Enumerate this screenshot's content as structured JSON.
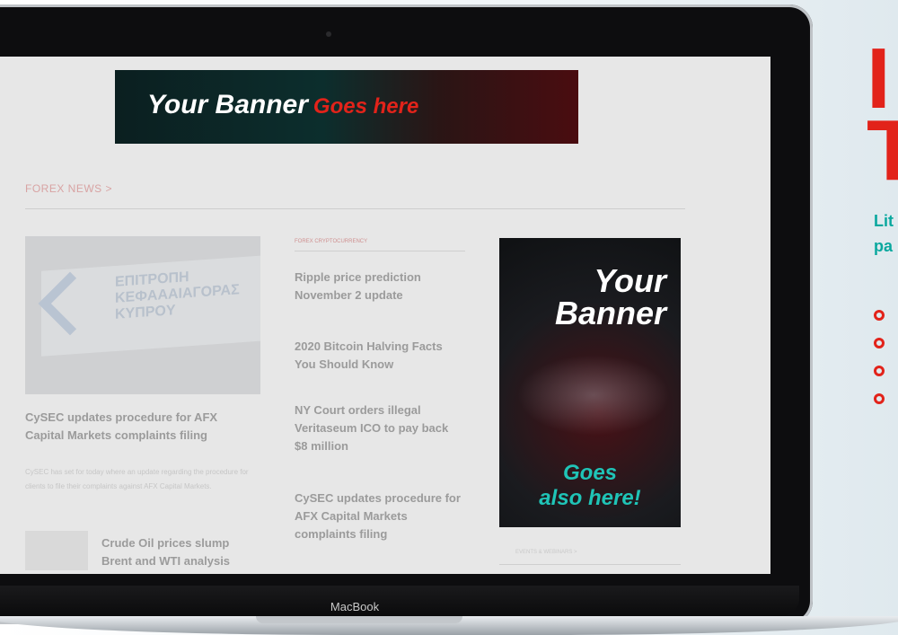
{
  "promo": {
    "headline_line1": "I",
    "headline_line2": "T",
    "lede_line1": "Lit",
    "lede_line2": "pa",
    "bullet_count": 4,
    "colors": {
      "headline": "#e2231a",
      "lede": "#0aa89e",
      "bullet": "#e2231a"
    }
  },
  "laptop": {
    "brand": "MacBook"
  },
  "site": {
    "top_banner": {
      "main": "Your Banner",
      "sub": "Goes here"
    },
    "section_title": "FOREX NEWS >",
    "featured_image_text": [
      "EПITPOПH",
      "KEФAAAIAГOPAΣ",
      "KYПPOY"
    ],
    "featured": {
      "headline_line1": "CySEC updates procedure for AFX",
      "headline_line2": "Capital Markets complaints filing",
      "excerpt": "CySEC has set for today where an update regarding the procedure for clients to file their complaints against AFX Capital Markets."
    },
    "bottom_item": {
      "headline_line1": "Crude Oil prices slump",
      "headline_line2": "Brent and WTI analysis"
    },
    "center_tab_label": "FOREX CRYPTOCURRENCY",
    "center_list": [
      {
        "line1": "Ripple price prediction",
        "line2": "November 2 update",
        "line3": ""
      },
      {
        "line1": "2020 Bitcoin Halving Facts",
        "line2": "You Should Know",
        "line3": ""
      },
      {
        "line1": "NY Court orders illegal",
        "line2": "Veritaseum ICO to pay back",
        "line3": "$8 million"
      },
      {
        "line1": "CySEC updates procedure for",
        "line2": "AFX Capital Markets",
        "line3": "complaints filing"
      }
    ],
    "side_banner": {
      "line1": "Your",
      "line2": "Banner",
      "line3": "Goes",
      "line4": "also here!"
    },
    "side_label": "EVENTS & WEBINARS >"
  }
}
